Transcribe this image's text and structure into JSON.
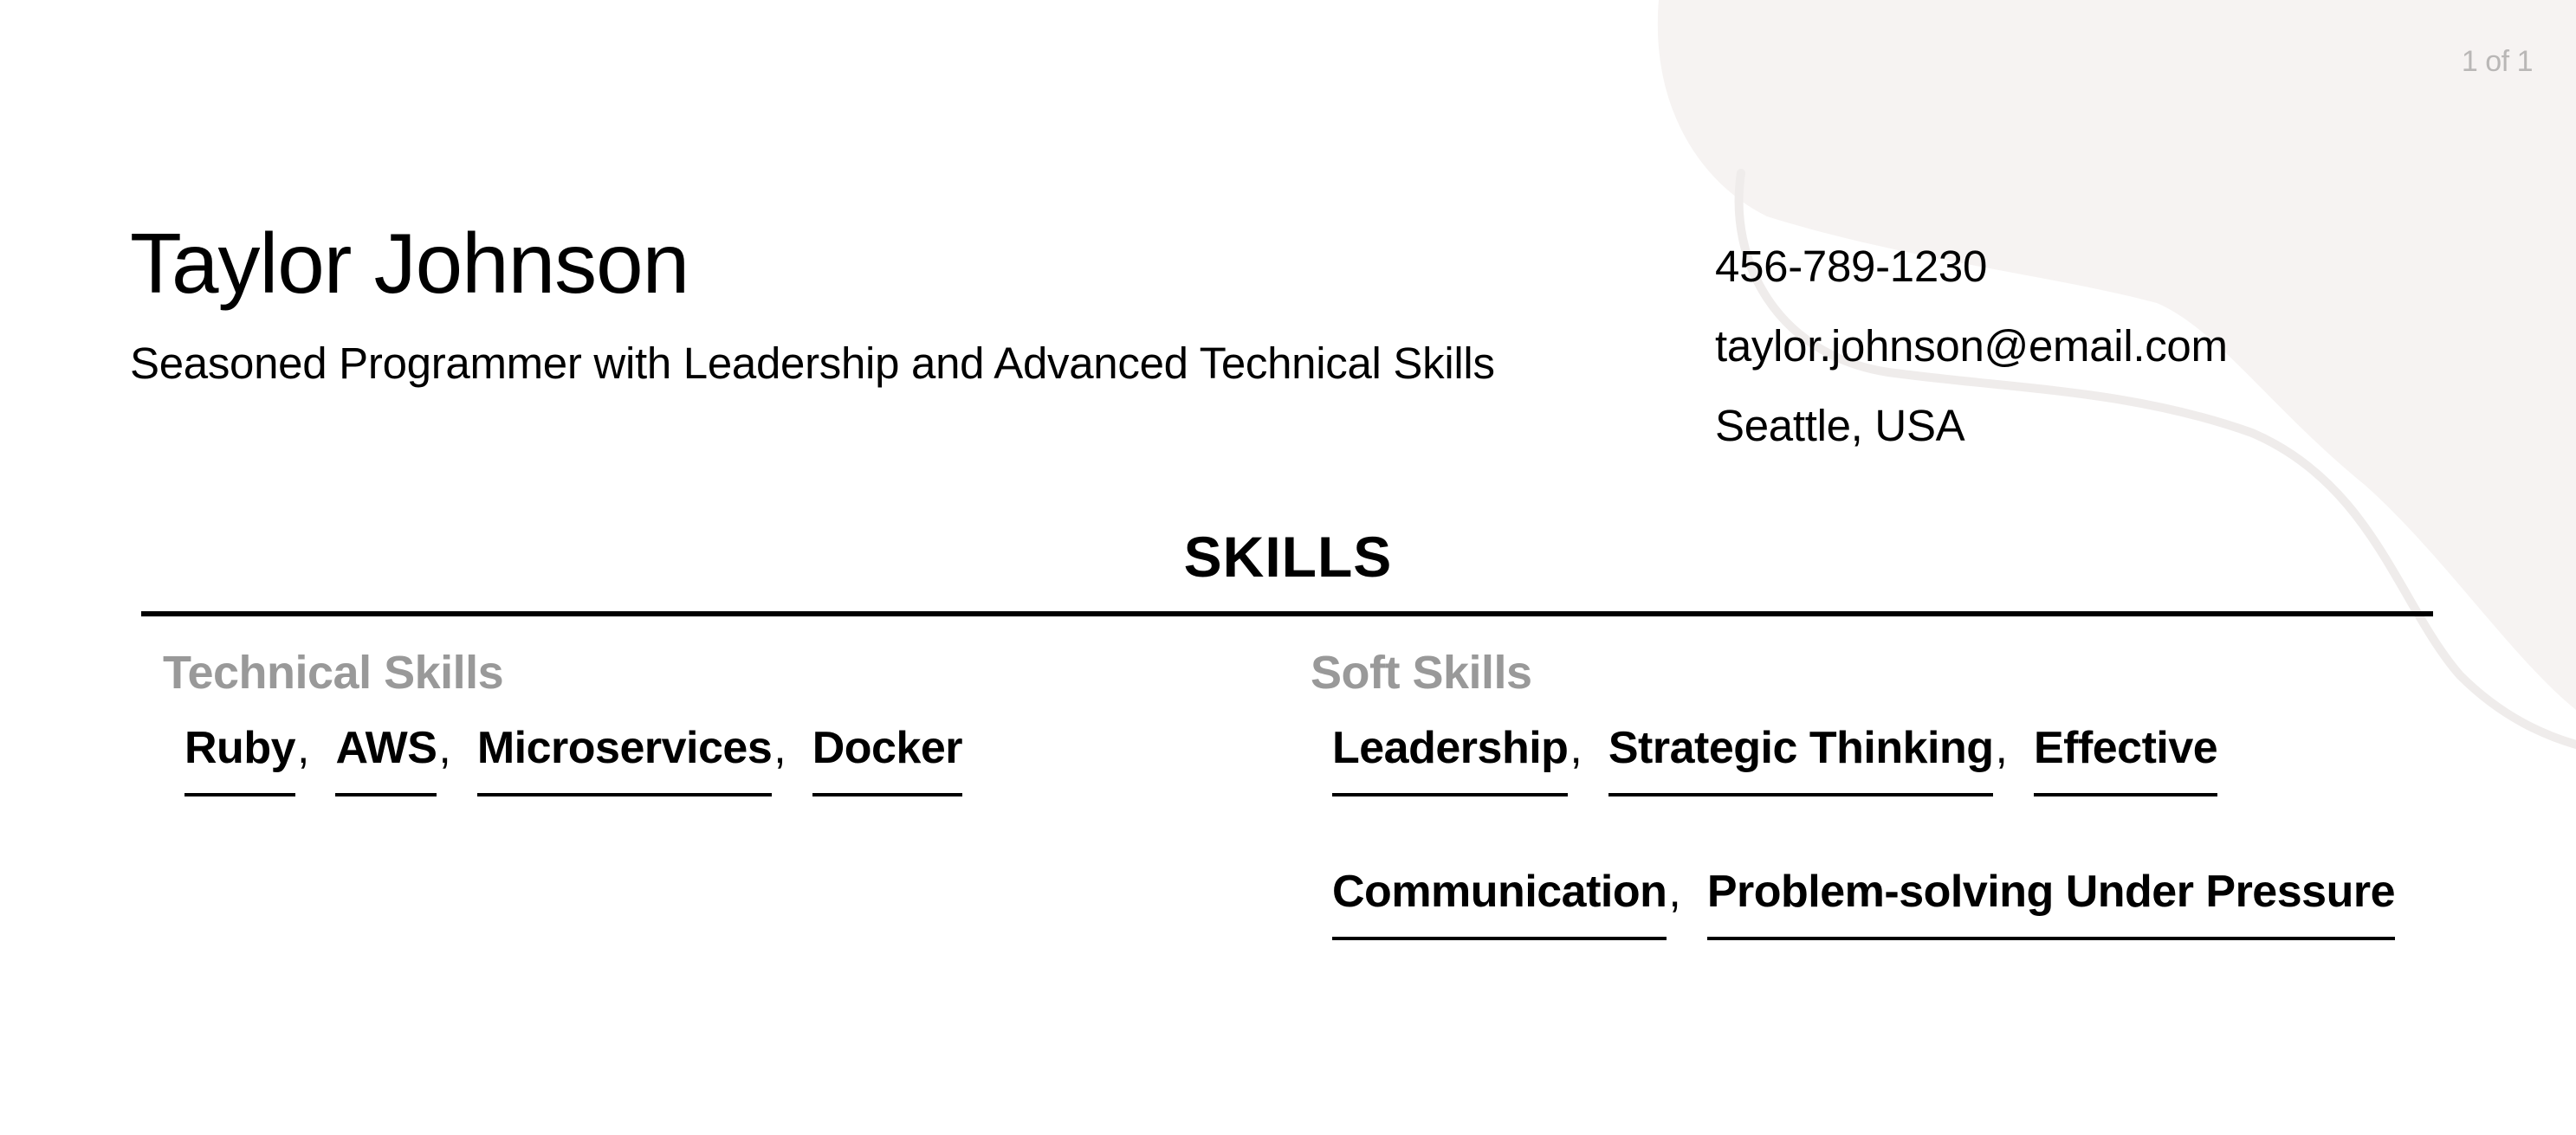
{
  "page": {
    "counter": "1 of 1"
  },
  "colors": {
    "decor_fill": "#f6f3f2",
    "heading_muted": "#999999",
    "counter_text": "#b9b7b6",
    "text": "#000000"
  },
  "header": {
    "name": "Taylor Johnson",
    "tagline": "Seasoned Programmer with Leadership and Advanced Technical Skills",
    "contact": {
      "phone": "456-789-1230",
      "email": "taylor.johnson@email.com",
      "location": "Seattle, USA"
    }
  },
  "skills": {
    "title": "SKILLS",
    "technical": {
      "heading": "Technical Skills",
      "items": [
        {
          "label": "Ruby",
          "sep": ","
        },
        {
          "label": "AWS",
          "sep": ","
        },
        {
          "label": "Microservices",
          "sep": ","
        },
        {
          "label": "Docker",
          "sep": ""
        }
      ]
    },
    "soft": {
      "heading": "Soft Skills",
      "items": [
        {
          "label": "Leadership",
          "sep": ","
        },
        {
          "label": "Strategic Thinking",
          "sep": ","
        },
        {
          "label": "Effective",
          "sep": ""
        },
        {
          "label": "Communication",
          "sep": ","
        },
        {
          "label": "Problem-solving Under Pressure",
          "sep": ""
        }
      ]
    }
  }
}
